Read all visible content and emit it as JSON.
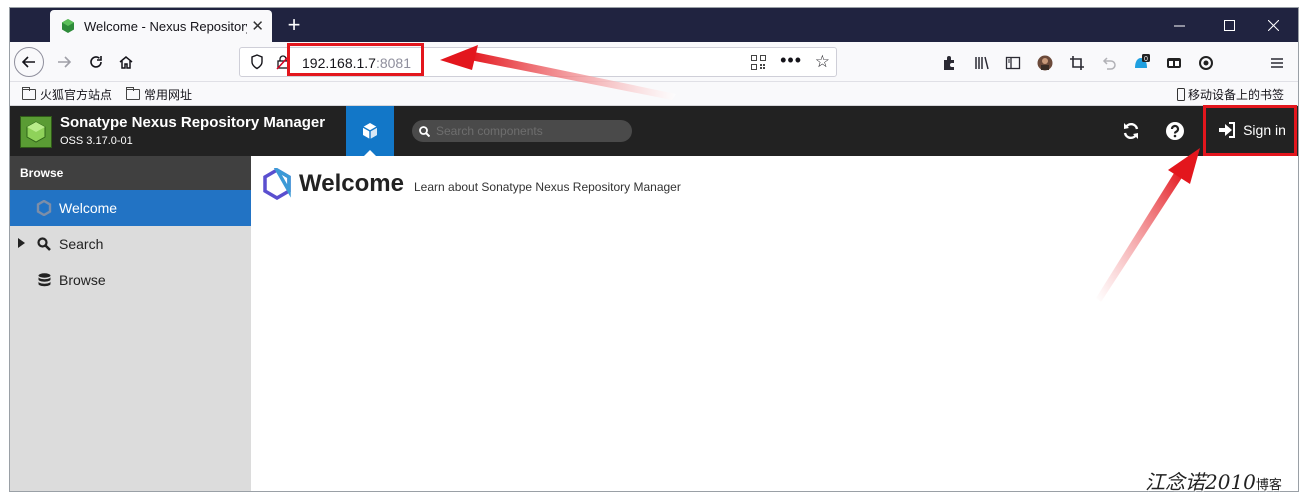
{
  "browser": {
    "tab_title": "Welcome - Nexus Repository",
    "tab_close": "✕",
    "new_tab": "+",
    "url_host": "192.168.1.7",
    "url_port": ":8081",
    "more_menu": "•••",
    "extension_badge": "0",
    "bookmarks": [
      "火狐官方站点",
      "常用网址"
    ],
    "mobile_bookmarks": "移动设备上的书签"
  },
  "app": {
    "title": "Sonatype Nexus Repository Manager",
    "version": "OSS 3.17.0-01",
    "search_placeholder": "Search components",
    "sign_in": "Sign in",
    "accent_color": "#1277c8"
  },
  "sidebar": {
    "header": "Browse",
    "items": [
      {
        "label": "Welcome",
        "icon": "nexus-hex-icon",
        "active": true
      },
      {
        "label": "Search",
        "icon": "magnifier-icon",
        "active": false
      },
      {
        "label": "Browse",
        "icon": "database-icon",
        "active": false
      }
    ]
  },
  "main": {
    "title": "Welcome",
    "subtitle": "Learn about Sonatype Nexus Repository Manager"
  },
  "watermark": {
    "text": "江念诺2010",
    "suffix": "博客"
  }
}
